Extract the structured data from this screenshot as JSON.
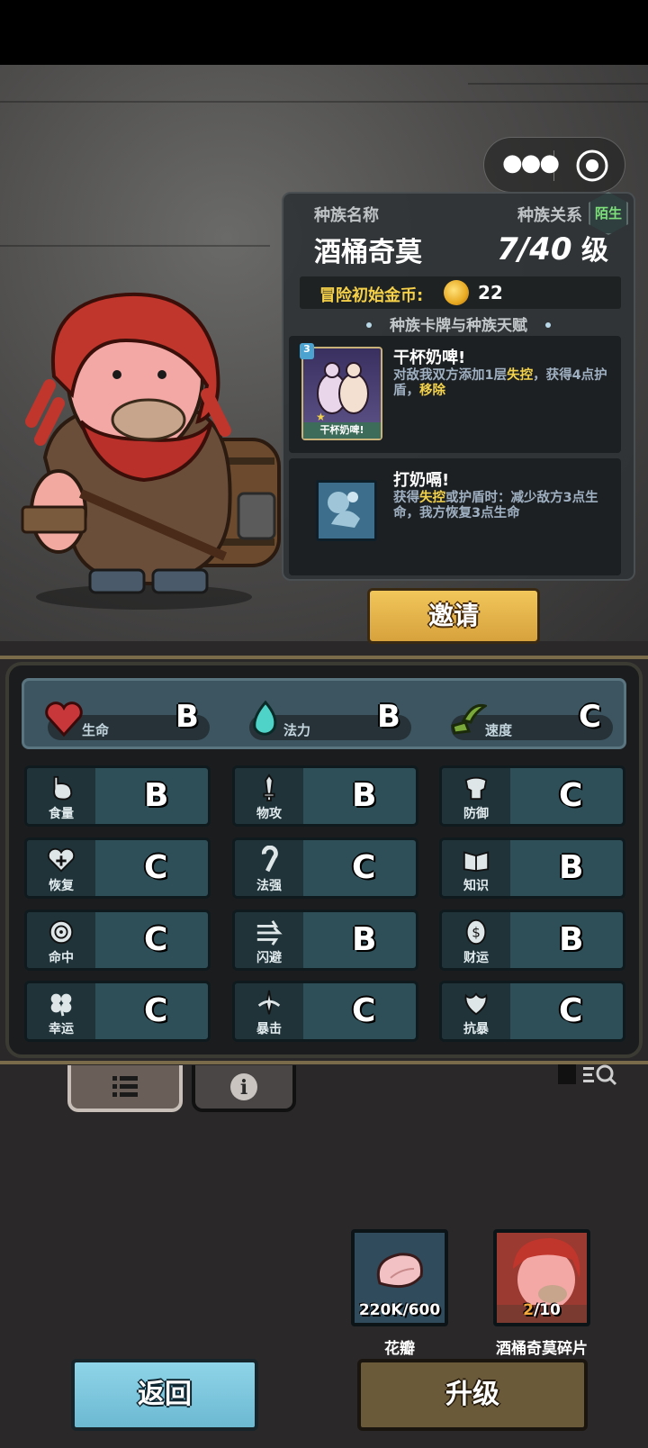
{
  "mini_program": {
    "more_icon": "ellipsis-icon",
    "close_icon": "target-circle-icon"
  },
  "race": {
    "name_label": "种族名称",
    "name": "酒桶奇莫",
    "relation_label": "种族关系",
    "relation": "陌生",
    "level_current": "7",
    "level_max": "40",
    "level_suffix": "级",
    "gold_label": "冒险初始金币:",
    "gold_value": "22",
    "section_title": "种族卡牌与种族天赋"
  },
  "card": {
    "title": "干杯奶啤!",
    "desc_prefix": "对敌我双方添加1层",
    "desc_hl1": "失控",
    "desc_mid": "，获得4点护盾，",
    "desc_hl2": "移除",
    "mini_name": "干杯奶啤!",
    "cost": "3"
  },
  "talent": {
    "title": "打奶嗝!",
    "desc_prefix": "获得",
    "desc_hl": "失控",
    "desc_rest": "或护盾时：减少敌方3点生命，我方恢复3点生命"
  },
  "invite_label": "邀请",
  "top_stats": [
    {
      "name": "生命",
      "grade": "B",
      "icon": "heart-icon",
      "color": "#c8383a"
    },
    {
      "name": "法力",
      "grade": "B",
      "icon": "flame-icon",
      "color": "#4fd3c8"
    },
    {
      "name": "速度",
      "grade": "C",
      "icon": "wing-boot-icon",
      "color": "#7aa83a"
    }
  ],
  "stats": [
    {
      "name": "食量",
      "grade": "B",
      "icon": "stomach-icon"
    },
    {
      "name": "物攻",
      "grade": "B",
      "icon": "sword-icon"
    },
    {
      "name": "防御",
      "grade": "C",
      "icon": "armor-icon"
    },
    {
      "name": "恢复",
      "grade": "C",
      "icon": "heart-plus-icon"
    },
    {
      "name": "法强",
      "grade": "C",
      "icon": "staff-icon"
    },
    {
      "name": "知识",
      "grade": "B",
      "icon": "book-icon"
    },
    {
      "name": "命中",
      "grade": "C",
      "icon": "target-icon"
    },
    {
      "name": "闪避",
      "grade": "B",
      "icon": "dodge-arrows-icon"
    },
    {
      "name": "财运",
      "grade": "B",
      "icon": "coin-icon"
    },
    {
      "name": "幸运",
      "grade": "C",
      "icon": "clover-icon"
    },
    {
      "name": "暴击",
      "grade": "C",
      "icon": "crit-dagger-icon"
    },
    {
      "name": "抗暴",
      "grade": "C",
      "icon": "shield-flower-icon"
    }
  ],
  "tabs": [
    {
      "icon": "list-icon"
    },
    {
      "icon": "info-icon"
    }
  ],
  "items": [
    {
      "label": "花瓣",
      "count": "220K/600",
      "icon": "petal-icon"
    },
    {
      "label": "酒桶奇莫碎片",
      "count_cur": "2",
      "count_max": "/10",
      "icon": "portrait-icon"
    }
  ],
  "back_label": "返回",
  "upgrade_label": "升级"
}
